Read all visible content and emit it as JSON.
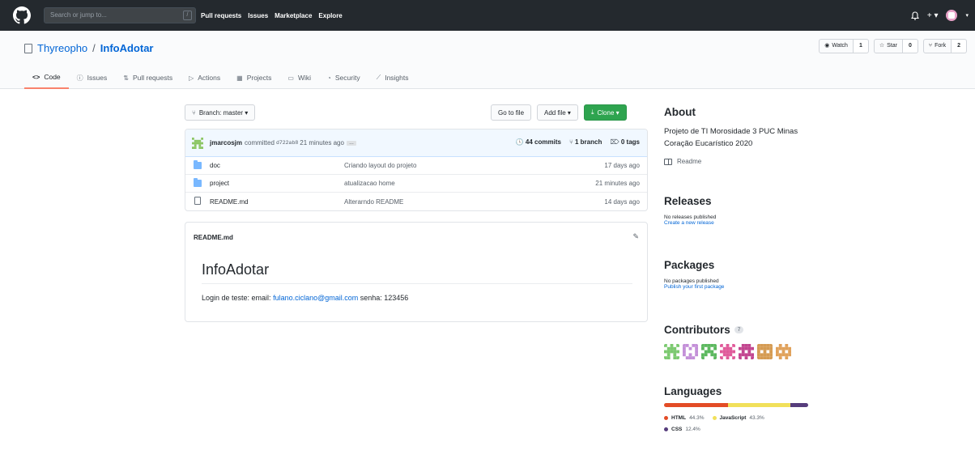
{
  "header": {
    "search_placeholder": "Search or jump to...",
    "search_key": "/",
    "nav": [
      "Pull requests",
      "Issues",
      "Marketplace",
      "Explore"
    ],
    "notifications_icon": "bell-icon",
    "plus_label": "+ ▾",
    "caret": "▾"
  },
  "repo": {
    "owner": "Thyreopho",
    "separator": "/",
    "name": "InfoAdotar",
    "watch_label": "Watch",
    "watch_count": "1",
    "star_label": "Star",
    "star_count": "0",
    "fork_label": "Fork",
    "fork_count": "2"
  },
  "tabs": [
    {
      "icon": "<>",
      "label": "Code"
    },
    {
      "icon": "ⓘ",
      "label": "Issues"
    },
    {
      "icon": "⇅",
      "label": "Pull requests"
    },
    {
      "icon": "▷",
      "label": "Actions"
    },
    {
      "icon": "▦",
      "label": "Projects"
    },
    {
      "icon": "▭",
      "label": "Wiki"
    },
    {
      "icon": "◔",
      "label": "Security"
    },
    {
      "icon": "⟋",
      "label": "Insights"
    }
  ],
  "toolbar": {
    "branch_label": "Branch: master ▾",
    "go_to_file": "Go to file",
    "add_file": "Add file ▾",
    "clone": "Clone ▾"
  },
  "commit": {
    "author": "jmarcosjm",
    "action": "committed",
    "sha": "d722ab8",
    "time": "21 minutes ago",
    "ellipsis": "…",
    "commits_count": "44 commits",
    "branch_count": "1 branch",
    "tags_count": "0 tags"
  },
  "files": [
    {
      "type": "folder",
      "name": "doc",
      "message": "Criando layout do projeto",
      "age": "17 days ago"
    },
    {
      "type": "folder",
      "name": "project",
      "message": "atualizacao home",
      "age": "21 minutes ago"
    },
    {
      "type": "file",
      "name": "README.md",
      "message": "Alterarndo README",
      "age": "14 days ago"
    }
  ],
  "readme": {
    "filename": "README.md",
    "heading": "InfoAdotar",
    "body_prefix": "Login de teste: email: ",
    "email": "fulano.ciclano@gmail.com",
    "body_suffix": " senha: 123456"
  },
  "sidebar": {
    "about_title": "About",
    "about_desc": "Projeto de TI Morosidade 3 PUC Minas Coração Eucarístico 2020",
    "readme_label": "Readme",
    "releases_title": "Releases",
    "releases_none": "No releases published",
    "releases_link": "Create a new release",
    "packages_title": "Packages",
    "packages_none": "No packages published",
    "packages_link": "Publish your first package",
    "contributors_title": "Contributors",
    "contributors_count": "7",
    "languages_title": "Languages",
    "languages": [
      {
        "name": "HTML",
        "percent": "44.3%",
        "value": 44.3,
        "color": "#e34c26"
      },
      {
        "name": "JavaScript",
        "percent": "43.3%",
        "value": 43.3,
        "color": "#f1e05a"
      },
      {
        "name": "CSS",
        "percent": "12.4%",
        "value": 12.4,
        "color": "#563d7c"
      }
    ],
    "contributor_colors": [
      "#7bc96f",
      "#c38fd8",
      "#5bb85e",
      "#e05a9a",
      "#c2458f",
      "#d59b52",
      "#e0a15a"
    ]
  }
}
